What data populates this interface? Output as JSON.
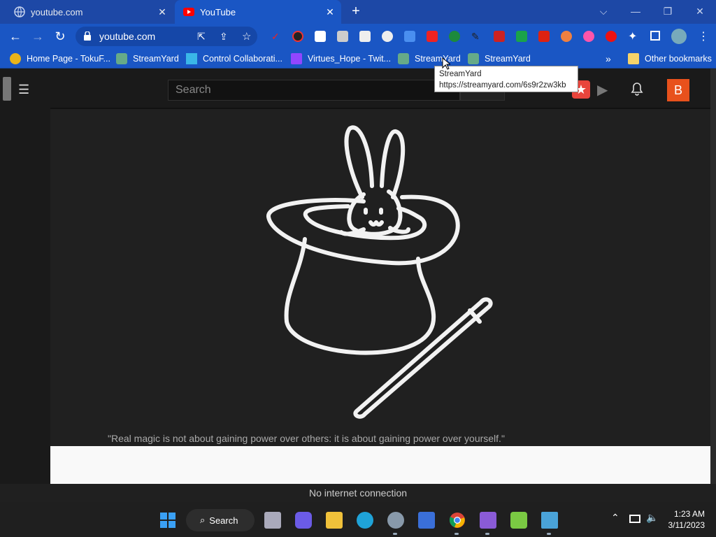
{
  "tabs": [
    {
      "title": "youtube.com",
      "close": "✕"
    },
    {
      "title": "YouTube",
      "close": "✕"
    }
  ],
  "toolbar": {
    "url": "youtube.com"
  },
  "bookmarks": [
    {
      "label": "Home Page - TokuF..."
    },
    {
      "label": "StreamYard"
    },
    {
      "label": "Control Collaborati..."
    },
    {
      "label": "Virtues_Hope - Twit..."
    },
    {
      "label": "StreamYard"
    },
    {
      "label": "StreamYard"
    },
    {
      "label": "Other bookmarks"
    }
  ],
  "tooltip": {
    "title": "StreamYard",
    "url": "https://streamyard.com/6s9r2zw3kb"
  },
  "youtube": {
    "search_placeholder": "Search",
    "avatar_letter": "B",
    "quote": "\"Real magic is not about gaining power over others: it is about gaining power over yourself.\""
  },
  "status": {
    "offline": "No internet connection"
  },
  "taskbar": {
    "search_label": "Search",
    "time": "1:23 AM",
    "date": "3/11/2023"
  },
  "colors": {
    "chrome_blue": "#1a56c4",
    "yt_bg": "#202020",
    "avatar": "#e8511c"
  }
}
